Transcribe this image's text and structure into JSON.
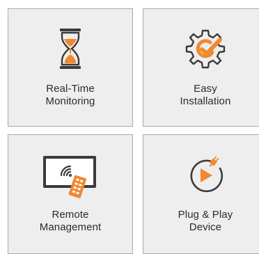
{
  "tiles": [
    {
      "line1": "Real-Time",
      "line2": "Monitoring",
      "icon": "hourglass-icon"
    },
    {
      "line1": "Easy",
      "line2": "Installation",
      "icon": "gear-check-icon"
    },
    {
      "line1": "Remote",
      "line2": "Management",
      "icon": "tablet-remote-icon"
    },
    {
      "line1": "Plug & Play",
      "line2": "Device",
      "icon": "plug-play-icon"
    }
  ],
  "colors": {
    "accent": "#f0892f",
    "dark": "#3a3a3a",
    "tile_bg": "#eeeeee",
    "tile_border": "#a9a9a9"
  }
}
